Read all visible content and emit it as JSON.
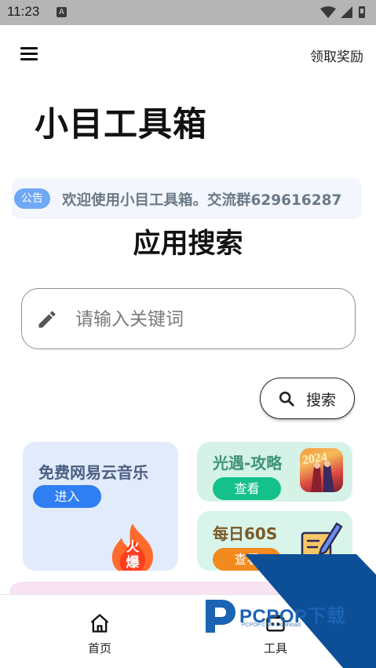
{
  "status_bar": {
    "time": "11:23",
    "notif_letter": "A"
  },
  "header": {
    "reward_label": "领取奖励",
    "title": "小目工具箱"
  },
  "notice": {
    "badge": "公告",
    "text": "欢迎使用小目工具箱。交流群629616287"
  },
  "search": {
    "heading": "应用搜索",
    "placeholder": "请输入关键词",
    "value": "",
    "button_label": "搜索"
  },
  "cards": {
    "music": {
      "title": "免费网易云音乐",
      "button": "进入",
      "hot_badge": "火爆"
    },
    "sky": {
      "title": "光遇-攻略",
      "button": "查看",
      "image_text": "2024"
    },
    "news60s": {
      "title": "每日60S",
      "button": "查看"
    }
  },
  "bottom_nav": {
    "items": [
      {
        "label": "首页",
        "icon": "home-icon"
      },
      {
        "label": "工具",
        "icon": "toolbox-icon"
      }
    ]
  },
  "watermark": {
    "brand": "PCPOP下载",
    "sub": "PCPOP.COM Download"
  },
  "colors": {
    "accent_blue": "#2f7ef2",
    "accent_green": "#14c18b",
    "accent_orange": "#f28a1e",
    "watermark_blue": "#1b63b3"
  }
}
